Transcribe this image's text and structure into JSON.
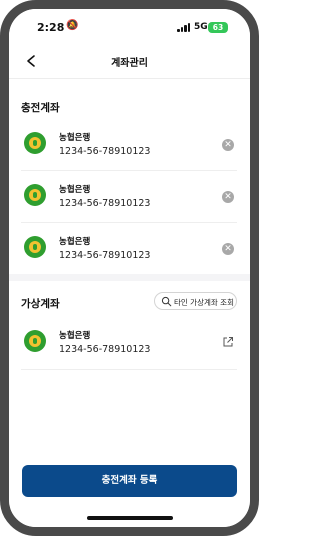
{
  "status_bar": {
    "time": "2:28",
    "network": "5G",
    "battery": "63"
  },
  "nav": {
    "title": "계좌관리"
  },
  "charge_section": {
    "title": "충전계좌",
    "accounts": [
      {
        "bank": "농협은행",
        "number": "1234-56-78910123"
      },
      {
        "bank": "농협은행",
        "number": "1234-56-78910123"
      },
      {
        "bank": "농협은행",
        "number": "1234-56-78910123"
      }
    ]
  },
  "virtual_section": {
    "title": "가상계좌",
    "lookup_button": "타인 가상계좌 조회",
    "accounts": [
      {
        "bank": "농협은행",
        "number": "1234-56-78910123"
      }
    ]
  },
  "register_button": "충전계좌 등록",
  "colors": {
    "primary": "#0b4a8b",
    "nh_green": "#2f9e2f",
    "nh_yellow": "#f2c230",
    "battery": "#34c759"
  }
}
